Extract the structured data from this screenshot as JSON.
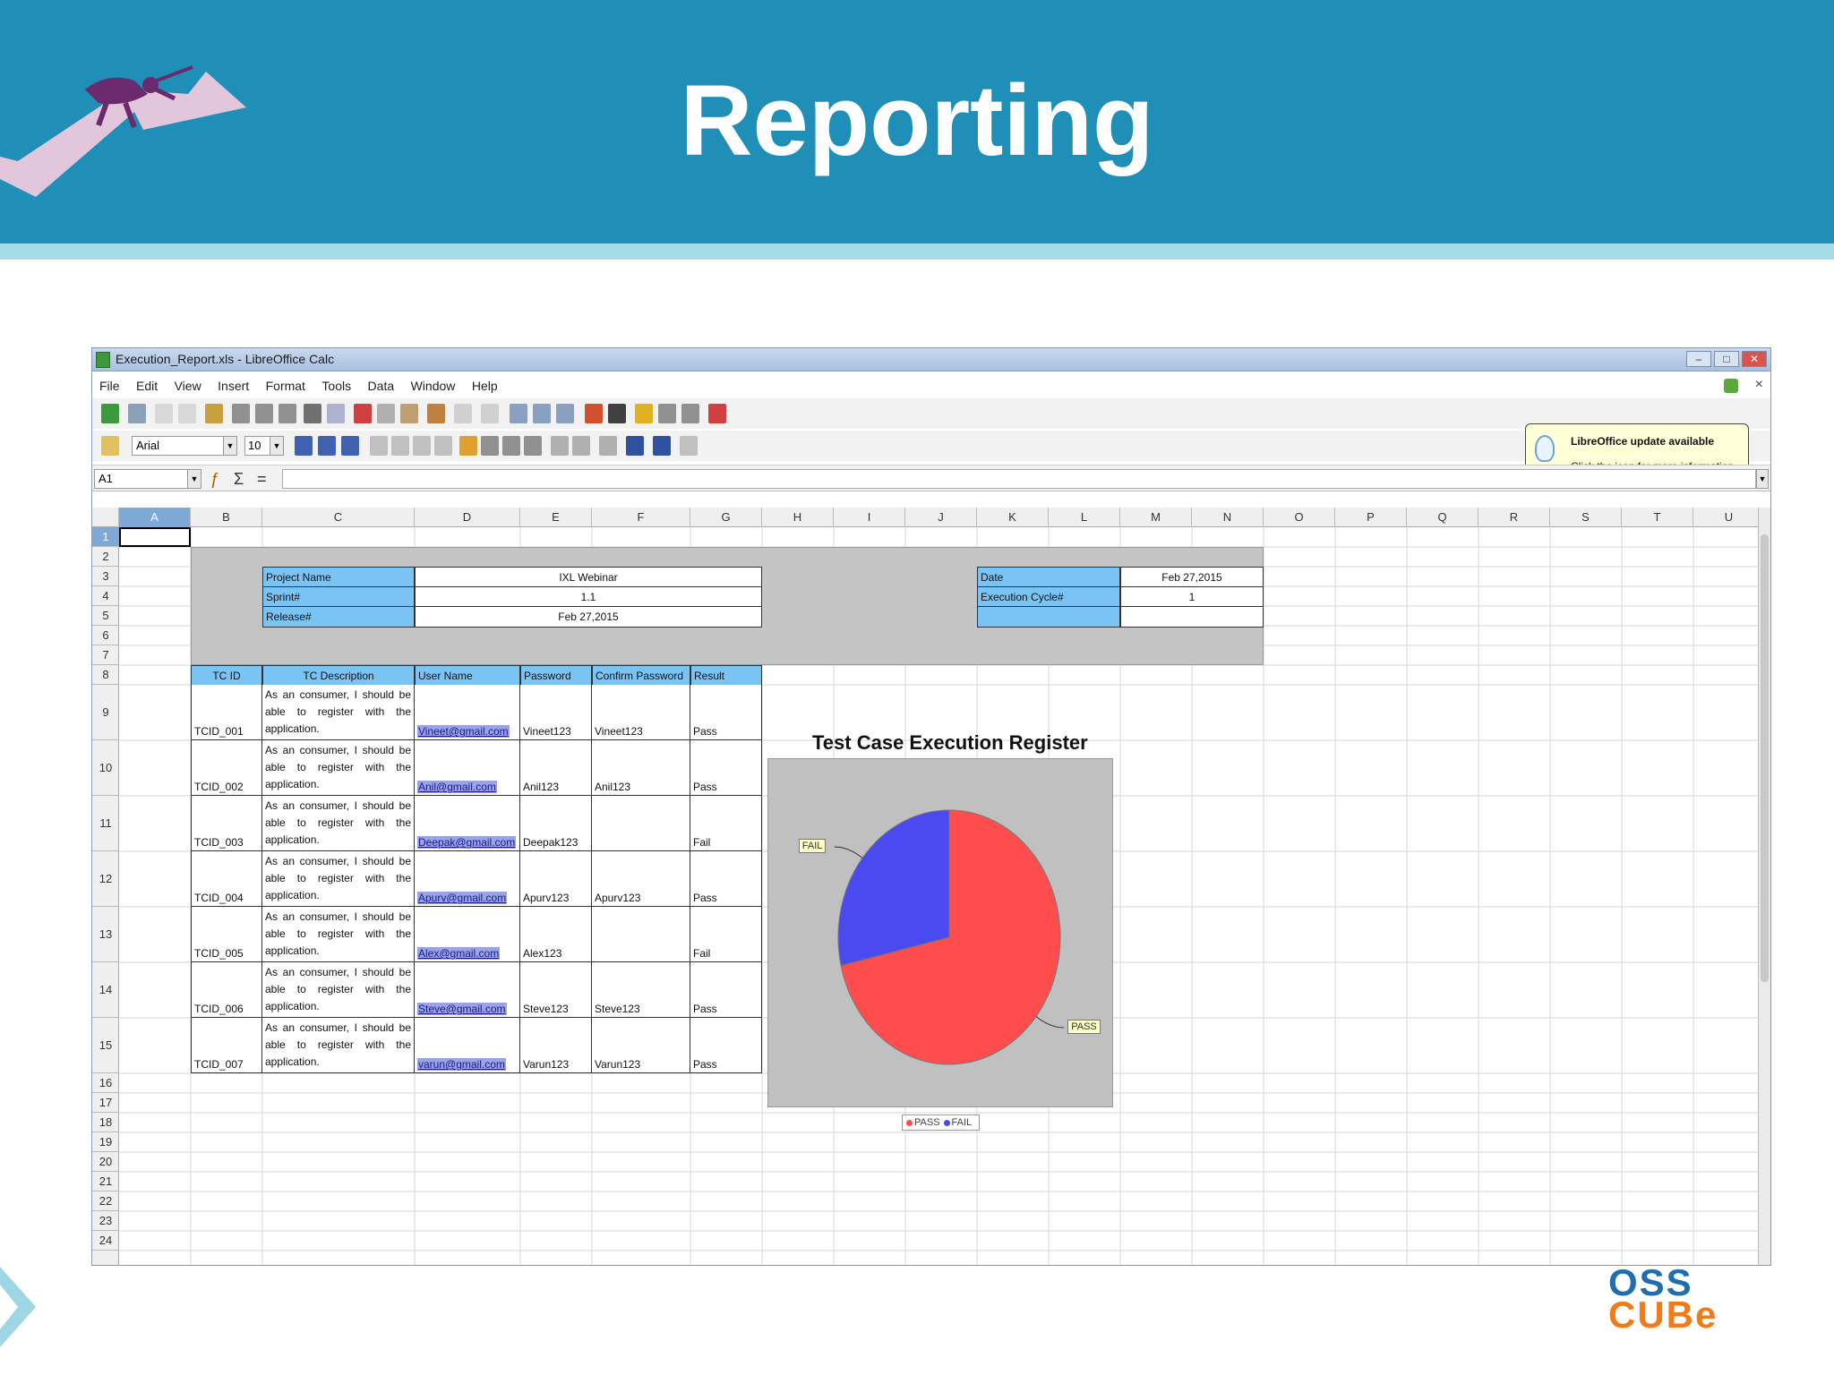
{
  "slide": {
    "title": "Reporting"
  },
  "window": {
    "title": "Execution_Report.xls - LibreOffice Calc",
    "controls": [
      "–",
      "□",
      "✕"
    ]
  },
  "menu": [
    "File",
    "Edit",
    "View",
    "Insert",
    "Format",
    "Tools",
    "Data",
    "Window",
    "Help"
  ],
  "menu_close": "×",
  "toolbar": {
    "font_name": "Arial",
    "font_size": "10"
  },
  "formula_bar": {
    "cell_ref": "A1",
    "value": ""
  },
  "update_notice": {
    "title": "LibreOffice update available",
    "text": "Click the icon for more information."
  },
  "columns": [
    "A",
    "B",
    "C",
    "D",
    "E",
    "F",
    "G",
    "H",
    "I",
    "J",
    "K",
    "L",
    "M",
    "N",
    "O",
    "P",
    "Q",
    "R",
    "S",
    "T",
    "U"
  ],
  "rows": [
    "1",
    "2",
    "3",
    "4",
    "5",
    "6",
    "7",
    "8",
    "9",
    "10",
    "11",
    "12",
    "13",
    "14",
    "15",
    "16",
    "17",
    "18",
    "19",
    "20",
    "21",
    "22",
    "23",
    "24"
  ],
  "project_info": {
    "project_name_label": "Project Name",
    "project_name": "IXL Webinar",
    "sprint_label": "Sprint#",
    "sprint": "1.1",
    "release_label": "Release#",
    "release": "Feb 27,2015",
    "date_label": "Date",
    "date": "Feb 27,2015",
    "cycle_label": "Execution Cycle#",
    "cycle": "1"
  },
  "test_table": {
    "headers": [
      "TC ID",
      "TC Description",
      "User Name",
      "Password",
      "Confirm Password",
      "Result"
    ],
    "rows": [
      {
        "id": "TCID_001",
        "desc": "As an consumer, I should be able to register with the application.",
        "user": "Vineet@gmail.com",
        "pass": "Vineet123",
        "confirm": "Vineet123",
        "result": "Pass"
      },
      {
        "id": "TCID_002",
        "desc": "As an consumer, I should be able to register with the application.",
        "user": "Anil@gmail.com",
        "pass": "Anil123",
        "confirm": "Anil123",
        "result": "Pass"
      },
      {
        "id": "TCID_003",
        "desc": "As an consumer, I should be able to register with the application.",
        "user": "Deepak@gmail.com",
        "pass": "Deepak123",
        "confirm": "",
        "result": "Fail"
      },
      {
        "id": "TCID_004",
        "desc": "As an consumer, I should be able to register with the application.",
        "user": "Apurv@gmail.com",
        "pass": "Apurv123",
        "confirm": "Apurv123",
        "result": "Pass"
      },
      {
        "id": "TCID_005",
        "desc": "As an consumer, I should be able to register with the application.",
        "user": "Alex@gmail.com",
        "pass": "Alex123",
        "confirm": "",
        "result": "Fail"
      },
      {
        "id": "TCID_006",
        "desc": "As an consumer, I should be able to register with the application.",
        "user": "Steve@gmail.com",
        "pass": "Steve123",
        "confirm": "Steve123",
        "result": "Pass"
      },
      {
        "id": "TCID_007",
        "desc": "As an consumer, I should be able to register with the application.",
        "user": "varun@gmail.com",
        "pass": "Varun123",
        "confirm": "Varun123",
        "result": "Pass"
      }
    ]
  },
  "chart_data": {
    "type": "pie",
    "title": "Test Case Execution Register",
    "categories": [
      "PASS",
      "FAIL"
    ],
    "values": [
      5,
      2
    ],
    "colors": [
      "#ff4d4d",
      "#4a4af0"
    ],
    "legend": [
      "PASS",
      "FAIL"
    ],
    "legend_position": "bottom"
  },
  "logo": {
    "line1": "OSS",
    "line2": "CUBe"
  },
  "colors": {
    "banner": "#1f8fb8",
    "header_cell": "#7ac3f5",
    "panel": "#c4c4c4"
  }
}
